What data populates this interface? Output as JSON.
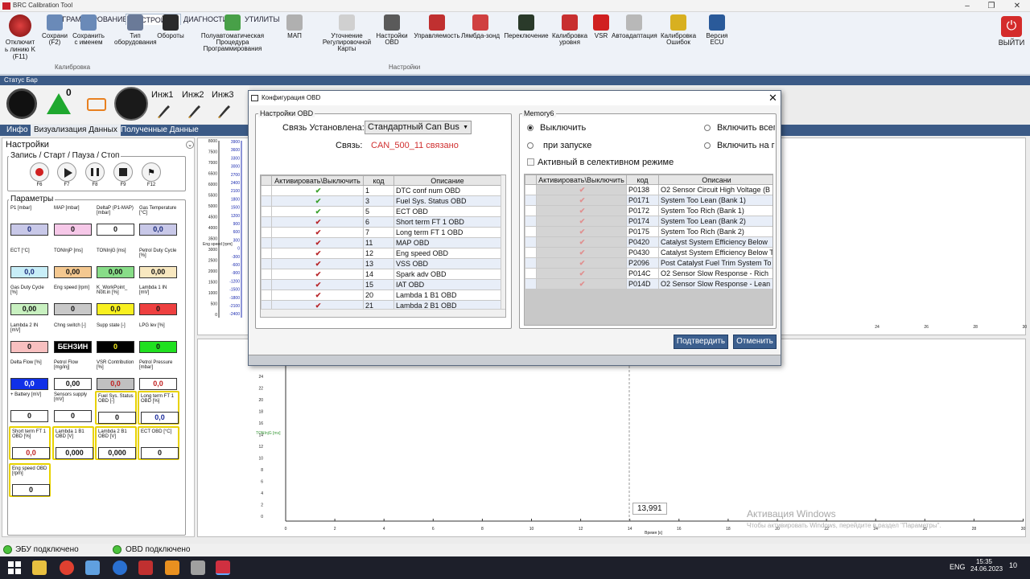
{
  "window": {
    "title": "BRC Calibration Tool"
  },
  "ribbon": {
    "tabs": [
      "ПРОГРАММИРОВАНИЕ",
      "НАСТРОЙКИ",
      "ДИАГНОСТИКА",
      "УТИЛИТЫ"
    ],
    "disconnect": {
      "l1": "Отключит",
      "l2": "ь линию K",
      "l3": "(F11)"
    },
    "buttons": [
      {
        "l1": "Сохрани",
        "l2": "(F2)"
      },
      {
        "l1": "Сохранить",
        "l2": "с именем"
      },
      {
        "l1": "Тип",
        "l2": "оборудования"
      },
      {
        "l1": "Обороты",
        "l2": ""
      },
      {
        "l1": "Полуавтоматическая",
        "l2": "Процедура Программирования"
      },
      {
        "l1": "МАП",
        "l2": ""
      },
      {
        "l1": "Уточнение",
        "l2": "Регулировочной Карты"
      },
      {
        "l1": "Настройки",
        "l2": "OBD"
      },
      {
        "l1": "Управляемость",
        "l2": ""
      },
      {
        "l1": "Лямбда-зонд",
        "l2": ""
      },
      {
        "l1": "Переключение",
        "l2": ""
      },
      {
        "l1": "Калибровка",
        "l2": "уровня"
      },
      {
        "l1": "VSR",
        "l2": ""
      },
      {
        "l1": "Автоадаптация",
        "l2": ""
      },
      {
        "l1": "Калибровка",
        "l2": "Ошибок"
      },
      {
        "l1": "Версия",
        "l2": "ECU"
      }
    ],
    "groups": {
      "calibration": "Калибровка",
      "settings": "Настройки"
    },
    "exit": "ВЫЙТИ"
  },
  "statusbar": {
    "title": "Статус Бар",
    "warn_count": "0",
    "injectors": [
      "Инж1",
      "Инж2",
      "Инж3"
    ]
  },
  "panel_tabs": [
    "Инфо",
    "Визуализация Данных",
    "Полученные Данные"
  ],
  "left": {
    "settings_title": "Настройки",
    "rec_group": "Запись / Старт / Пауза / Стоп",
    "rec_keys": [
      "F6",
      "F7",
      "F8",
      "F9",
      "F12"
    ],
    "params_title": "Параметры",
    "params": [
      {
        "label": "P1 [mbar]",
        "value": "0",
        "bg": "#c8c8e8"
      },
      {
        "label": "MAP [mbar]",
        "value": "0",
        "bg": "#f6c8e8"
      },
      {
        "label": "DeltaP (P1-MAP) [mbar]",
        "value": "0",
        "bg": "#ffffff"
      },
      {
        "label": "Gas Temperature [°C]",
        "value": "0,0",
        "bg": "#c8c8e8"
      },
      {
        "label": "ECT [°C]",
        "value": "0,0",
        "bg": "#c8eef8"
      },
      {
        "label": "TONInjP [ms]",
        "value": "0,00",
        "bg": "#f4c890"
      },
      {
        "label": "TONInjG [ms]",
        "value": "0,00",
        "bg": "#88dd88"
      },
      {
        "label": "Petrol Duty Cycle [%]",
        "value": "0,00",
        "bg": "#f8e8c0"
      },
      {
        "label": "Gas Duty Cycle [%]",
        "value": "0,00",
        "bg": "#c8f0c0"
      },
      {
        "label": "Eng speed [rpm]",
        "value": "0",
        "bg": "#c8c8c8"
      },
      {
        "label": "K_WorkPoint_ Nott.in [%]",
        "value": "0,0",
        "bg": "#f8f020"
      },
      {
        "label": "Lambda 1 IN [mV]",
        "value": "0",
        "bg": "#ee4040"
      },
      {
        "label": "Lambda 2 IN [mV]",
        "value": "0",
        "bg": "#f8c0c0"
      },
      {
        "label": "Chng switch [-]",
        "value": "БЕНЗИН",
        "bg": "#000000"
      },
      {
        "label": "Supp state [-]",
        "value": "0",
        "bg": "#000000"
      },
      {
        "label": "LPG lev [%]",
        "value": "0",
        "bg": "#20e020"
      },
      {
        "label": "Delta Flow [%]",
        "value": "0,0",
        "bg": "#1030e8"
      },
      {
        "label": "Petrol Flow [mg/inj]",
        "value": "0,00",
        "bg": "#ffffff"
      },
      {
        "label": "VSR Contribution [%]",
        "value": "0,0",
        "bg": "#c0c0c0"
      },
      {
        "label": "Petrol Pressure [mbar]",
        "value": "0,0",
        "bg": "#ffffff"
      },
      {
        "label": "+ Battery [mV]",
        "value": "0",
        "bg": "#ffffff"
      },
      {
        "label": "Sensors supply [mV]",
        "value": "0",
        "bg": "#ffffff"
      },
      {
        "label": "Fuel Sys. Status OBD [-]",
        "value": "0",
        "bg": "#ffffff"
      },
      {
        "label": "Long term FT 1 OBD [%]",
        "value": "0,0",
        "bg": "#ffffff"
      },
      {
        "label": "Short term FT 1 OBD [%]",
        "value": "0,0",
        "bg": "#ffffff"
      },
      {
        "label": "Lambda 1 B1 OBD [V]",
        "value": "0,000",
        "bg": "#ffffff"
      },
      {
        "label": "Lambda 2 B1 OBD [V]",
        "value": "0,000",
        "bg": "#ffffff"
      },
      {
        "label": "ECT OBD [°C]",
        "value": "0",
        "bg": "#ffffff"
      },
      {
        "label": "Eng speed OBD [rpm]",
        "value": "0",
        "bg": "#ffffff"
      }
    ]
  },
  "graph": {
    "g1_ticks": [
      "8000",
      "7500",
      "7000",
      "6500",
      "6000",
      "5500",
      "5000",
      "4500",
      "4000",
      "3500",
      "3000",
      "2500",
      "2000",
      "1500",
      "1000",
      "500",
      "0"
    ],
    "g1_ticks2": [
      "3900",
      "3600",
      "3300",
      "3000",
      "2700",
      "2400",
      "2100",
      "1800",
      "1500",
      "1200",
      "900",
      "600",
      "300",
      "0",
      "-300",
      "-600",
      "-900",
      "-1200",
      "-1500",
      "-1800",
      "-2100",
      "-2400"
    ],
    "g1_label": "Eng speed [rpm]",
    "x_ticks_right": [
      "24",
      "26",
      "28",
      "30"
    ],
    "g2_yticks": [
      "24",
      "22",
      "20",
      "18",
      "16",
      "14",
      "12",
      "10",
      "8",
      "6",
      "4",
      "2",
      "0"
    ],
    "g2_label": "TONInjG [ms]",
    "x_ticks": [
      "0",
      "2",
      "4",
      "6",
      "8",
      "10",
      "12",
      "14",
      "16",
      "18",
      "20",
      "22",
      "24",
      "26",
      "28",
      "30"
    ],
    "xlabel": "Время [s]",
    "cursor_value": "13,991",
    "watermark1": "Активация Windows",
    "watermark2": "Чтобы активировать Windows, перейдите в раздел \"Параметры\"."
  },
  "dialog": {
    "title": "Конфигурация OBD",
    "obd_group": "Настройки OBD",
    "conn_label": "Связь Установлена:",
    "conn_value": "Стандартный Can Bus",
    "link_label": "Связь:",
    "link_value": "CAN_500_11 связано",
    "table_headers": [
      "Активировать\\Выключить",
      "код",
      "Описание"
    ],
    "rows": [
      {
        "state": "on",
        "code": "1",
        "desc": "DTC conf num OBD"
      },
      {
        "state": "on",
        "code": "3",
        "desc": "Fuel Sys. Status OBD"
      },
      {
        "state": "on",
        "code": "5",
        "desc": "ECT OBD"
      },
      {
        "state": "off",
        "code": "6",
        "desc": "Short term FT 1 OBD"
      },
      {
        "state": "off",
        "code": "7",
        "desc": "Long term FT 1 OBD"
      },
      {
        "state": "off",
        "code": "11",
        "desc": "MAP OBD"
      },
      {
        "state": "off",
        "code": "12",
        "desc": "Eng speed OBD"
      },
      {
        "state": "off",
        "code": "13",
        "desc": "VSS OBD"
      },
      {
        "state": "off",
        "code": "14",
        "desc": "Spark adv OBD"
      },
      {
        "state": "off",
        "code": "15",
        "desc": "IAT OBD"
      },
      {
        "state": "off",
        "code": "20",
        "desc": "Lambda 1 B1 OBD"
      },
      {
        "state": "off",
        "code": "21",
        "desc": "Lambda 2 B1 OBD"
      }
    ],
    "memory_group": "Memory6",
    "radio_off": "Выключить",
    "radio_start": "при запуске",
    "radio_all": "Включить всег",
    "radio_on": "Включить на г",
    "selective": "Активный в селективном режиме",
    "mem_headers": [
      "Активировать\\Выключить",
      "код",
      "Описани"
    ],
    "mem_rows": [
      {
        "code": "P0138",
        "desc": "O2 Sensor Circuit High Voltage (B"
      },
      {
        "code": "P0171",
        "desc": "System Too Lean (Bank 1)"
      },
      {
        "code": "P0172",
        "desc": "System Too Rich (Bank 1)"
      },
      {
        "code": "P0174",
        "desc": "System Too Lean (Bank 2)"
      },
      {
        "code": "P0175",
        "desc": "System Too Rich (Bank 2)"
      },
      {
        "code": "P0420",
        "desc": "Catalyst System Efficiency Below"
      },
      {
        "code": "P0430",
        "desc": "Catalyst System Efficiency Below T"
      },
      {
        "code": "P2096",
        "desc": "Post Catalyst Fuel Trim System To"
      },
      {
        "code": "P014C",
        "desc": "O2 Sensor Slow Response - Rich"
      },
      {
        "code": "P014D",
        "desc": "O2 Sensor Slow Response - Lean"
      }
    ],
    "confirm": "Подтвердить",
    "cancel": "Отменить"
  },
  "bottom": {
    "ecu": "ЭБУ подключено",
    "obd": "OBD подключено"
  },
  "taskbar": {
    "lang": "ENG",
    "time": "15:35",
    "date": "24.06.2023",
    "notif": "10"
  }
}
